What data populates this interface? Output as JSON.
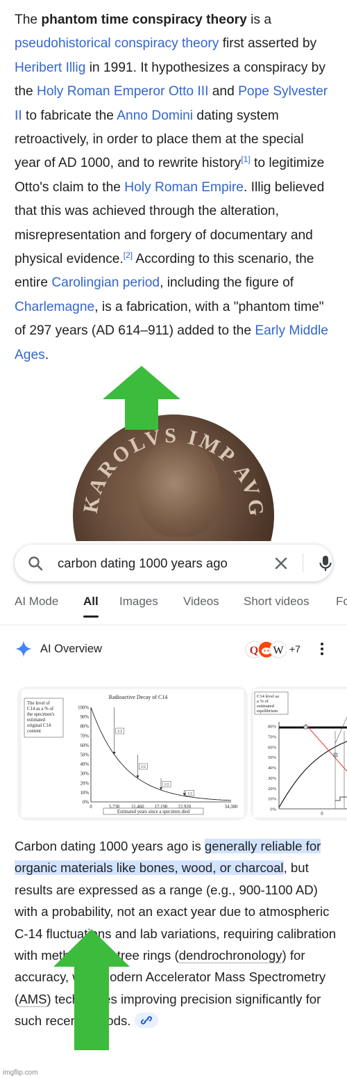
{
  "wiki": {
    "t1": "The ",
    "bold_title": "phantom time conspiracy theory",
    "t2": " is a ",
    "l_pseudo": "pseudohistorical conspiracy theory",
    "t3": " first asserted by ",
    "l_illig": "Heribert Illig",
    "t4": " in 1991. It hypothesizes a conspiracy by the ",
    "l_otto": "Holy Roman Emperor Otto III",
    "t5": " and ",
    "l_pope": "Pope Sylvester II",
    "t6": " to fabricate the ",
    "l_anno": "Anno Domini",
    "t7": " dating system retroactively, in order to place them at the special year of AD 1000, and to rewrite history",
    "ref1": "[1]",
    "t8": " to legitimize Otto's claim to the ",
    "l_hre": "Holy Roman Empire",
    "t9": ". Illig believed that this was achieved through the alteration, misrepresentation and forgery of documentary and physical evidence.",
    "ref2": "[2]",
    "t10": " According to this scenario, the entire ",
    "l_caro": "Carolingian period",
    "t11": ", including the figure of ",
    "l_charle": "Charlemagne",
    "t12": ", is a fabrication, with a \"phantom time\" of 297 years (AD 614–911) added to the ",
    "l_ema": "Early Middle Ages",
    "t13": "."
  },
  "coin": {
    "legend": "KAROLVS IMP AVG"
  },
  "search": {
    "query": "carbon dating 1000 years ago",
    "icons": {
      "search": "search-icon",
      "clear": "close-icon",
      "mic": "microphone-icon"
    }
  },
  "tabs": [
    "AI Mode",
    "All",
    "Images",
    "Videos",
    "Short videos",
    "Fo"
  ],
  "active_tab": "All",
  "ai_overview": {
    "title": "AI Overview",
    "source_count": "+7",
    "source_icons": [
      "quora-icon",
      "reddit-icon",
      "wikipedia-icon"
    ]
  },
  "chart_data": [
    {
      "type": "line",
      "title": "Radioactive Decay of C14",
      "ylabel": "The level of C14 as a % of the specimen's estimated original C14 content",
      "xlabel": "Estimated years since a specimen died",
      "x": [
        0,
        5730,
        11460,
        17190,
        22920,
        34380
      ],
      "xticks": [
        "0",
        "5,730",
        "11,460",
        "17,190",
        "22,920",
        "34,380"
      ],
      "yticks": [
        "100%",
        "90%",
        "80%",
        "70%",
        "60%",
        "50%",
        "40%",
        "30%",
        "20%",
        "10%",
        "0%"
      ],
      "ylim": [
        0,
        100
      ],
      "series": [
        {
          "values": [
            100,
            50,
            25,
            12.5,
            6.25,
            1.56
          ]
        }
      ],
      "annotations": [
        "1/2",
        "1/2",
        "1/2",
        "1/2"
      ]
    },
    {
      "type": "line",
      "ylabel": "C14 level as a % of estimated equilibrium",
      "yticks": [
        "80%",
        "70%",
        "60%",
        "50%",
        "40%",
        "30%",
        "20%",
        "10%",
        "0%"
      ],
      "xticks": [
        "0"
      ],
      "ylim": [
        0,
        85
      ]
    }
  ],
  "answer": {
    "a1": "Carbon dating 1000 years ago is ",
    "hl": "generally reliable for organic materials like bones, wood, or charcoal",
    "a2": ", but results are expressed as a range (e.g., 900-1100 AD) with a probability, not an exact year due to atmospheric C-14 fluctuations and lab variations, requiring calibration with methods like tree rings (",
    "dendro": "dendrochronology",
    "a3": ") for accuracy, with modern Accelerator Mass Spectrometry (",
    "ams": "AMS",
    "a4": ") techniques improving precision significantly for such recent periods."
  },
  "colors": {
    "link": "#3366cc",
    "arrow": "#3dbb3d",
    "highlight": "#d3e3fd"
  },
  "watermark": "imgflip.com"
}
